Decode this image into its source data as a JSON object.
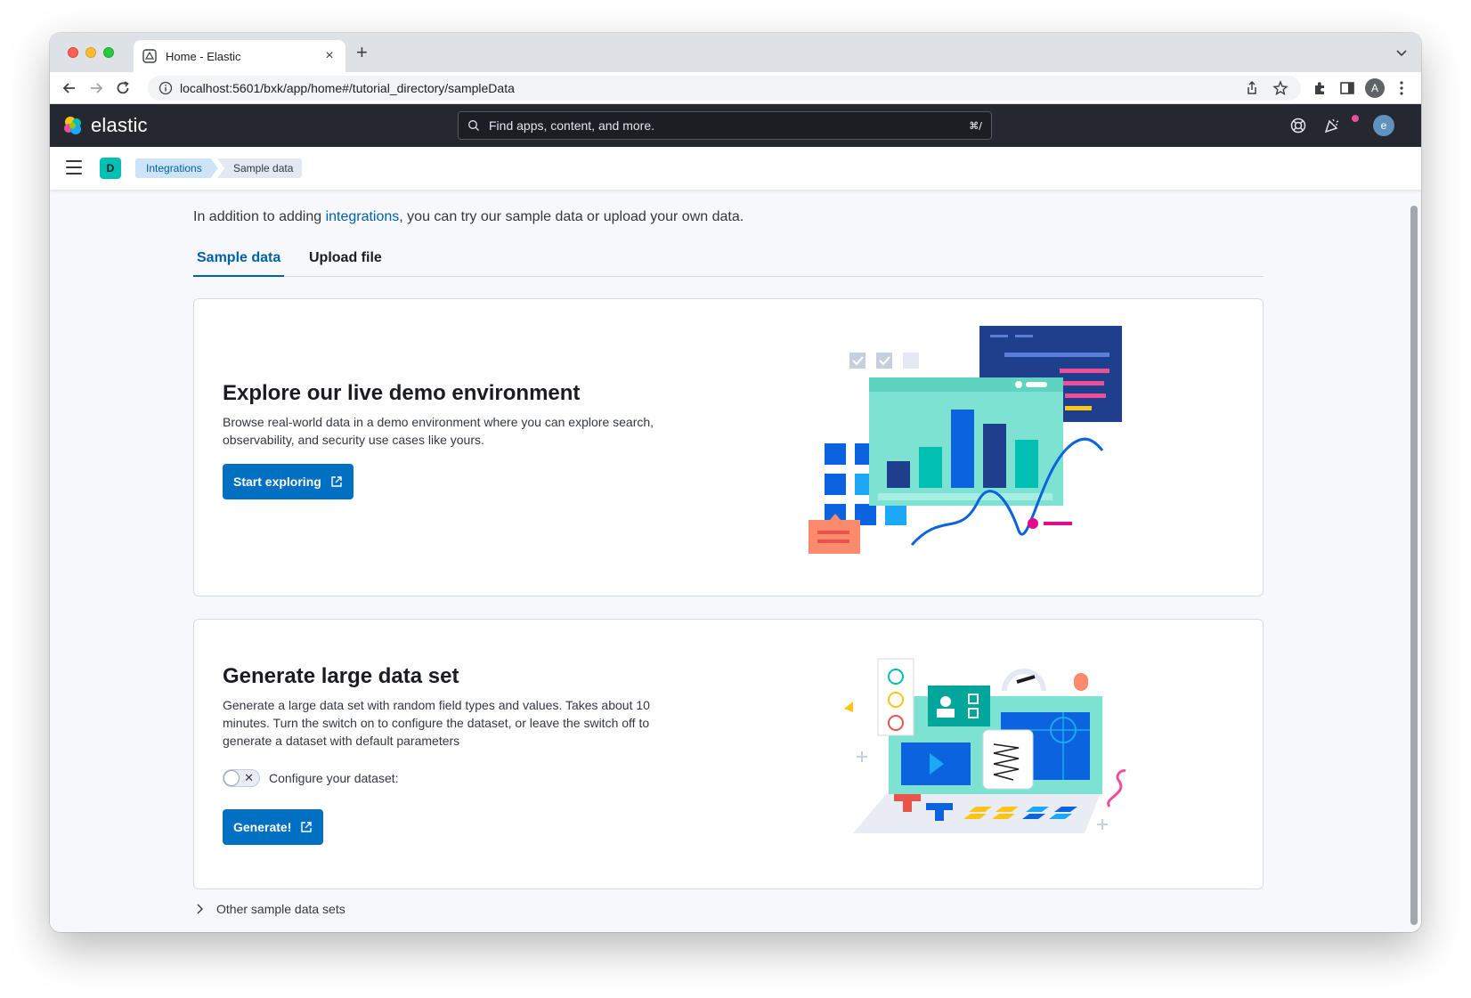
{
  "browser": {
    "tab_title": "Home - Elastic",
    "url": "localhost:5601/bxk/app/home#/tutorial_directory/sampleData",
    "profile_initial": "A"
  },
  "header": {
    "logo_text": "elastic",
    "search_placeholder": "Find apps, content, and more.",
    "search_shortcut": "⌘/",
    "user_initial": "e"
  },
  "breadcrumbs": {
    "space_initial": "D",
    "items": [
      {
        "label": "Integrations"
      },
      {
        "label": "Sample data"
      }
    ]
  },
  "intro": {
    "prefix": "In addition to adding ",
    "link": "integrations",
    "suffix": ", you can try our sample data or upload your own data."
  },
  "tabs": [
    {
      "label": "Sample data",
      "active": true
    },
    {
      "label": "Upload file",
      "active": false
    }
  ],
  "demo_panel": {
    "title": "Explore our live demo environment",
    "description": "Browse real-world data in a demo environment where you can explore search, observability, and security use cases like yours.",
    "button_label": "Start exploring"
  },
  "generate_panel": {
    "title": "Generate large data set",
    "description": "Generate a large data set with random field types and values. Takes about 10 minutes. Turn the switch on to configure the dataset, or leave the switch off to generate a dataset with default parameters",
    "switch_label": "Configure your dataset:",
    "switch_on": false,
    "button_label": "Generate!"
  },
  "other_sets_label": "Other sample data sets",
  "colors": {
    "primary": "#0071c2",
    "link": "#0061a6",
    "header_bg": "#25282f",
    "space_badge": "#00bfb3",
    "notification": "#f04e98"
  }
}
